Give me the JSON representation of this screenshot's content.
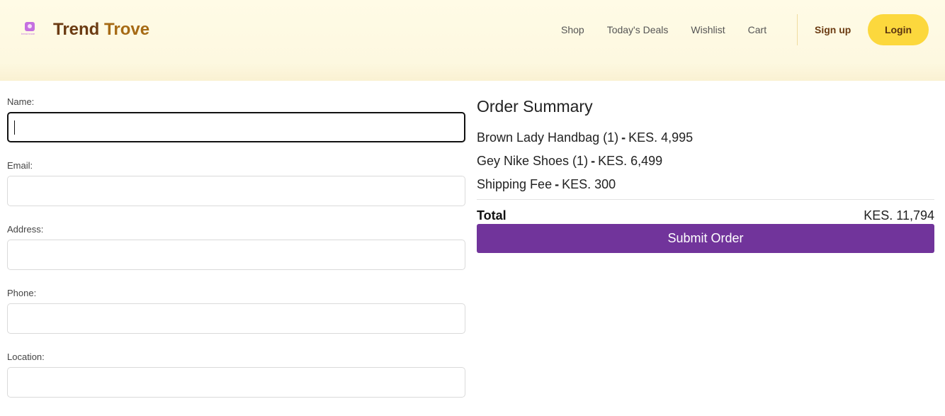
{
  "header": {
    "logo_icon": "trend-trove-logo-icon",
    "logo_tiny_text": "trend trove",
    "brand_part1": "Trend",
    "brand_part2": "Trove",
    "nav": [
      "Shop",
      "Today's Deals",
      "Wishlist",
      "Cart"
    ],
    "signup_label": "Sign up",
    "login_label": "Login"
  },
  "form": {
    "fields": [
      {
        "label": "Name:",
        "value": ""
      },
      {
        "label": "Email:",
        "value": ""
      },
      {
        "label": "Address:",
        "value": ""
      },
      {
        "label": "Phone:",
        "value": ""
      },
      {
        "label": "Location:",
        "value": ""
      }
    ]
  },
  "summary": {
    "title": "Order Summary",
    "items": [
      {
        "name": "Brown Lady Handbag (1)",
        "sep": "-",
        "price": "KES. 4,995"
      },
      {
        "name": "Gey Nike Shoes (1)",
        "sep": "-",
        "price": "KES. 6,499"
      },
      {
        "name": "Shipping Fee",
        "sep": "-",
        "price": "KES. 300"
      }
    ],
    "total_label": "Total",
    "total_value": "KES. 11,794",
    "submit_label": "Submit Order"
  },
  "colors": {
    "header_bg": "#fffbe6",
    "brand": "#6b3b12",
    "accent_yellow": "#fcd83d",
    "submit_purple": "#71349b"
  }
}
